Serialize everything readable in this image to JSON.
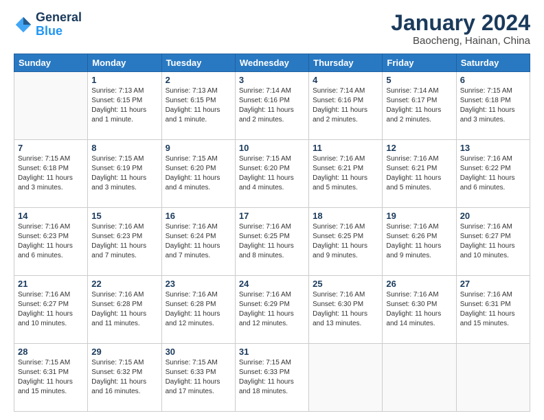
{
  "logo": {
    "text_general": "General",
    "text_blue": "Blue"
  },
  "header": {
    "month_title": "January 2024",
    "subtitle": "Baocheng, Hainan, China"
  },
  "weekdays": [
    "Sunday",
    "Monday",
    "Tuesday",
    "Wednesday",
    "Thursday",
    "Friday",
    "Saturday"
  ],
  "weeks": [
    [
      {
        "day": "",
        "info": ""
      },
      {
        "day": "1",
        "info": "Sunrise: 7:13 AM\nSunset: 6:15 PM\nDaylight: 11 hours\nand 1 minute."
      },
      {
        "day": "2",
        "info": "Sunrise: 7:13 AM\nSunset: 6:15 PM\nDaylight: 11 hours\nand 1 minute."
      },
      {
        "day": "3",
        "info": "Sunrise: 7:14 AM\nSunset: 6:16 PM\nDaylight: 11 hours\nand 2 minutes."
      },
      {
        "day": "4",
        "info": "Sunrise: 7:14 AM\nSunset: 6:16 PM\nDaylight: 11 hours\nand 2 minutes."
      },
      {
        "day": "5",
        "info": "Sunrise: 7:14 AM\nSunset: 6:17 PM\nDaylight: 11 hours\nand 2 minutes."
      },
      {
        "day": "6",
        "info": "Sunrise: 7:15 AM\nSunset: 6:18 PM\nDaylight: 11 hours\nand 3 minutes."
      }
    ],
    [
      {
        "day": "7",
        "info": "Sunrise: 7:15 AM\nSunset: 6:18 PM\nDaylight: 11 hours\nand 3 minutes."
      },
      {
        "day": "8",
        "info": "Sunrise: 7:15 AM\nSunset: 6:19 PM\nDaylight: 11 hours\nand 3 minutes."
      },
      {
        "day": "9",
        "info": "Sunrise: 7:15 AM\nSunset: 6:20 PM\nDaylight: 11 hours\nand 4 minutes."
      },
      {
        "day": "10",
        "info": "Sunrise: 7:15 AM\nSunset: 6:20 PM\nDaylight: 11 hours\nand 4 minutes."
      },
      {
        "day": "11",
        "info": "Sunrise: 7:16 AM\nSunset: 6:21 PM\nDaylight: 11 hours\nand 5 minutes."
      },
      {
        "day": "12",
        "info": "Sunrise: 7:16 AM\nSunset: 6:21 PM\nDaylight: 11 hours\nand 5 minutes."
      },
      {
        "day": "13",
        "info": "Sunrise: 7:16 AM\nSunset: 6:22 PM\nDaylight: 11 hours\nand 6 minutes."
      }
    ],
    [
      {
        "day": "14",
        "info": "Sunrise: 7:16 AM\nSunset: 6:23 PM\nDaylight: 11 hours\nand 6 minutes."
      },
      {
        "day": "15",
        "info": "Sunrise: 7:16 AM\nSunset: 6:23 PM\nDaylight: 11 hours\nand 7 minutes."
      },
      {
        "day": "16",
        "info": "Sunrise: 7:16 AM\nSunset: 6:24 PM\nDaylight: 11 hours\nand 7 minutes."
      },
      {
        "day": "17",
        "info": "Sunrise: 7:16 AM\nSunset: 6:25 PM\nDaylight: 11 hours\nand 8 minutes."
      },
      {
        "day": "18",
        "info": "Sunrise: 7:16 AM\nSunset: 6:25 PM\nDaylight: 11 hours\nand 9 minutes."
      },
      {
        "day": "19",
        "info": "Sunrise: 7:16 AM\nSunset: 6:26 PM\nDaylight: 11 hours\nand 9 minutes."
      },
      {
        "day": "20",
        "info": "Sunrise: 7:16 AM\nSunset: 6:27 PM\nDaylight: 11 hours\nand 10 minutes."
      }
    ],
    [
      {
        "day": "21",
        "info": "Sunrise: 7:16 AM\nSunset: 6:27 PM\nDaylight: 11 hours\nand 10 minutes."
      },
      {
        "day": "22",
        "info": "Sunrise: 7:16 AM\nSunset: 6:28 PM\nDaylight: 11 hours\nand 11 minutes."
      },
      {
        "day": "23",
        "info": "Sunrise: 7:16 AM\nSunset: 6:28 PM\nDaylight: 11 hours\nand 12 minutes."
      },
      {
        "day": "24",
        "info": "Sunrise: 7:16 AM\nSunset: 6:29 PM\nDaylight: 11 hours\nand 12 minutes."
      },
      {
        "day": "25",
        "info": "Sunrise: 7:16 AM\nSunset: 6:30 PM\nDaylight: 11 hours\nand 13 minutes."
      },
      {
        "day": "26",
        "info": "Sunrise: 7:16 AM\nSunset: 6:30 PM\nDaylight: 11 hours\nand 14 minutes."
      },
      {
        "day": "27",
        "info": "Sunrise: 7:16 AM\nSunset: 6:31 PM\nDaylight: 11 hours\nand 15 minutes."
      }
    ],
    [
      {
        "day": "28",
        "info": "Sunrise: 7:15 AM\nSunset: 6:31 PM\nDaylight: 11 hours\nand 15 minutes."
      },
      {
        "day": "29",
        "info": "Sunrise: 7:15 AM\nSunset: 6:32 PM\nDaylight: 11 hours\nand 16 minutes."
      },
      {
        "day": "30",
        "info": "Sunrise: 7:15 AM\nSunset: 6:33 PM\nDaylight: 11 hours\nand 17 minutes."
      },
      {
        "day": "31",
        "info": "Sunrise: 7:15 AM\nSunset: 6:33 PM\nDaylight: 11 hours\nand 18 minutes."
      },
      {
        "day": "",
        "info": ""
      },
      {
        "day": "",
        "info": ""
      },
      {
        "day": "",
        "info": ""
      }
    ]
  ]
}
